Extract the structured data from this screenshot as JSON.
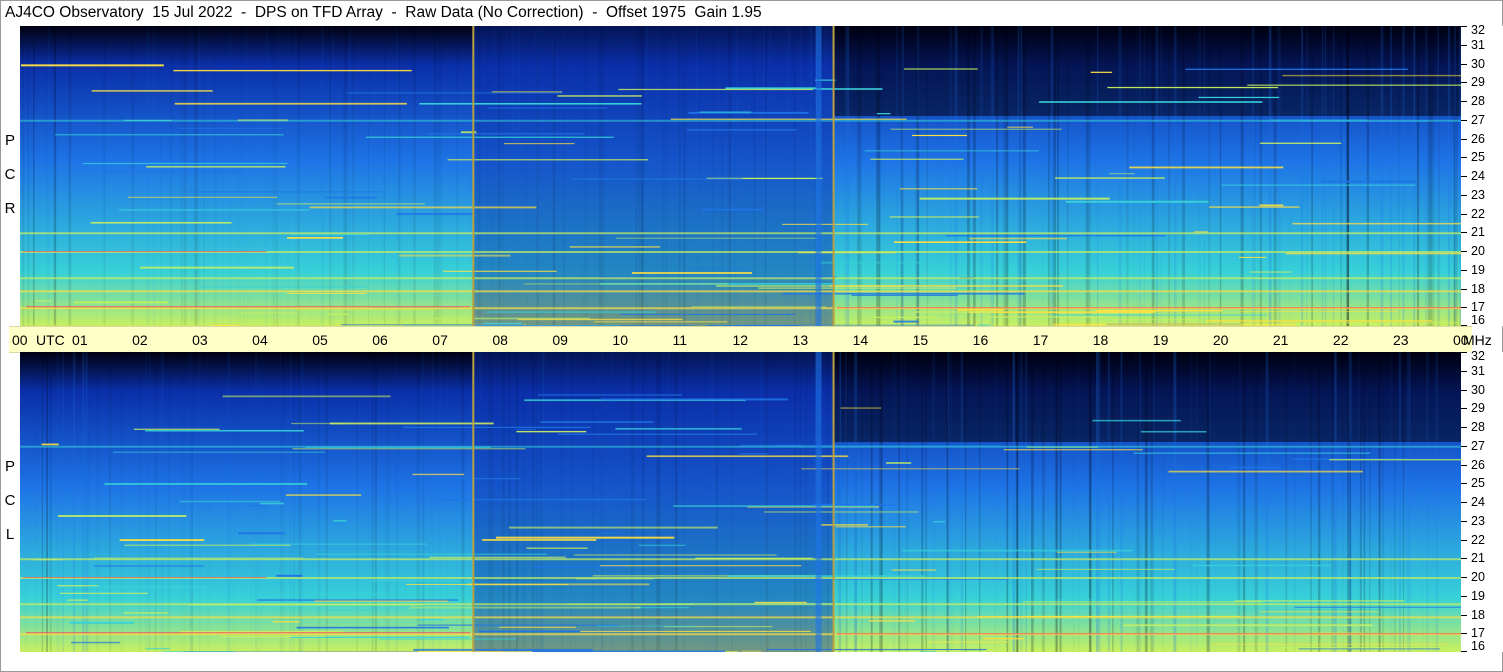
{
  "title": "AJ4CO Observatory  15 Jul 2022  -  DPS on TFD Array  -  Raw Data (No Correction)  -  Offset 1975  Gain 1.95",
  "panels": [
    {
      "id": "rcp",
      "letters": [
        "R",
        "C",
        "P"
      ]
    },
    {
      "id": "lcp",
      "letters": [
        "L",
        "C",
        "P"
      ]
    }
  ],
  "colors": {
    "background_deep": "#000010",
    "low": "#0a2fa8",
    "mid": "#1e74e6",
    "high": "#37d1d8",
    "hot": "#c8f060",
    "peak": "#ffe040",
    "spike": "#ff3a60",
    "marker_line": "#b8a040",
    "timebar_bg": "#ffffc8",
    "freq_strip_bg": "#fde6d2"
  },
  "chart_data": {
    "type": "heatmap",
    "title": "AJ4CO Observatory  15 Jul 2022  -  DPS on TFD Array  -  Raw Data (No Correction)  -  Offset 1975  Gain 1.95",
    "x_axis": {
      "tick_labels": [
        "00",
        "UTC",
        "01",
        "02",
        "03",
        "04",
        "05",
        "06",
        "07",
        "08",
        "09",
        "10",
        "11",
        "12",
        "13",
        "14",
        "15",
        "16",
        "17",
        "18",
        "19",
        "20",
        "21",
        "22",
        "23",
        "00",
        "MHz"
      ],
      "hours": [
        0,
        1,
        2,
        3,
        4,
        5,
        6,
        7,
        8,
        9,
        10,
        11,
        12,
        13,
        14,
        15,
        16,
        17,
        18,
        19,
        20,
        21,
        22,
        23,
        24
      ],
      "range": [
        0,
        24
      ],
      "unit": "UTC"
    },
    "y_axis": {
      "tick_labels": [
        "16",
        "17",
        "18",
        "19",
        "20",
        "21",
        "22",
        "23",
        "24",
        "25",
        "26",
        "27",
        "28",
        "29",
        "30",
        "31",
        "32"
      ],
      "range": [
        16,
        32
      ],
      "unit": "MHz"
    },
    "marker_times_utc": [
      7.55,
      13.55
    ],
    "series": [
      {
        "name": "RCP"
      },
      {
        "name": "LCP"
      }
    ],
    "grid": false,
    "strong_bands_mhz": [
      17.0,
      17.9,
      18.6,
      20.0,
      21.0,
      27.0
    ],
    "legend": "none"
  }
}
